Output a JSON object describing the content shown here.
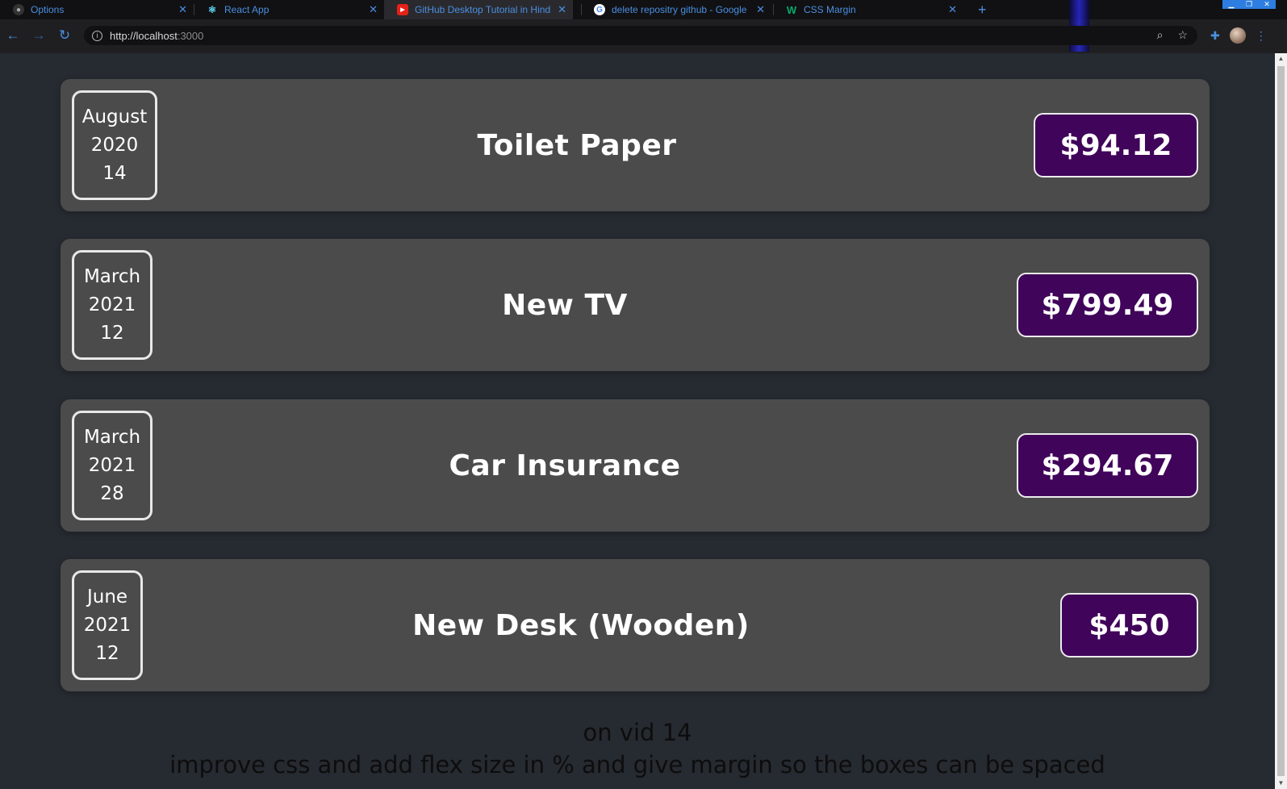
{
  "browser": {
    "tabs": [
      {
        "label": "Options",
        "icon": "github-icon"
      },
      {
        "label": "React App",
        "icon": "react-icon"
      },
      {
        "label": "GitHub Desktop Tutorial in Hindi",
        "icon": "youtube-icon"
      },
      {
        "label": "delete repositry github - Google S",
        "icon": "google-icon"
      },
      {
        "label": "CSS Margin",
        "icon": "w3schools-icon"
      }
    ],
    "url_host": "http://localhost",
    "url_port": ":3000",
    "accent_color": "#4a8fe0"
  },
  "expenses": [
    {
      "month": "August",
      "year": "2020",
      "day": "14",
      "title": "Toilet Paper",
      "amount": "$94.12"
    },
    {
      "month": "March",
      "year": "2021",
      "day": "12",
      "title": "New TV",
      "amount": "$799.49"
    },
    {
      "month": "March",
      "year": "2021",
      "day": "28",
      "title": "Car Insurance",
      "amount": "$294.67"
    },
    {
      "month": "June",
      "year": "2021",
      "day": "12",
      "title": "New Desk (Wooden)",
      "amount": "$450"
    }
  ],
  "notes": {
    "line1": "on vid 14",
    "line2": "improve css and add flex size in % and give margin so the boxes can be spaced"
  },
  "colors": {
    "page_bg": "#262a31",
    "card_bg": "#4b4b4b",
    "price_bg": "#40045a"
  }
}
